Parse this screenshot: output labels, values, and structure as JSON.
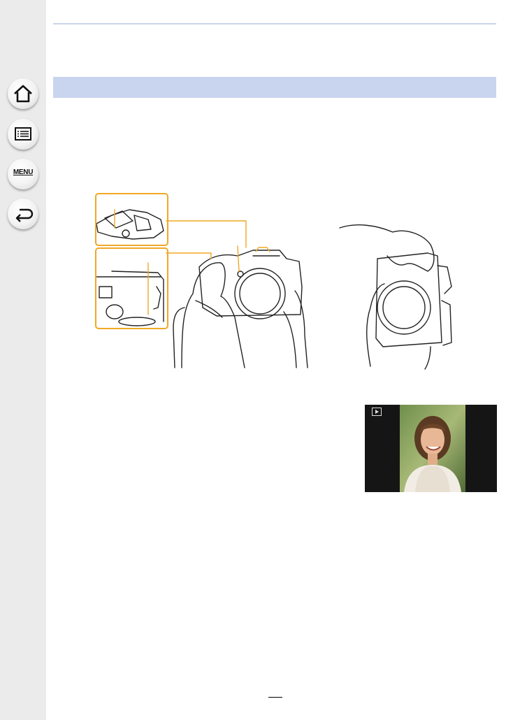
{
  "sidebar": {
    "buttons": [
      {
        "icon": "home-icon"
      },
      {
        "icon": "contents-list-icon"
      },
      {
        "icon": "menu-icon",
        "label": "MENU"
      },
      {
        "icon": "back-arrow-icon"
      }
    ]
  },
  "section": {
    "title": ""
  },
  "figures": {
    "camera_views": {
      "detail_views": [
        "flash-unit",
        "side-speaker"
      ],
      "views": [
        "front-grip",
        "vertical-grip"
      ]
    },
    "playback_screen": {
      "icon": "play-icon",
      "photo": "smiling-woman-portrait"
    }
  },
  "colors": {
    "sidebar_bg": "#ebebeb",
    "section_bar": "#c9d4ef",
    "callout_orange": "#f0a825",
    "screen_bg": "#151515"
  }
}
